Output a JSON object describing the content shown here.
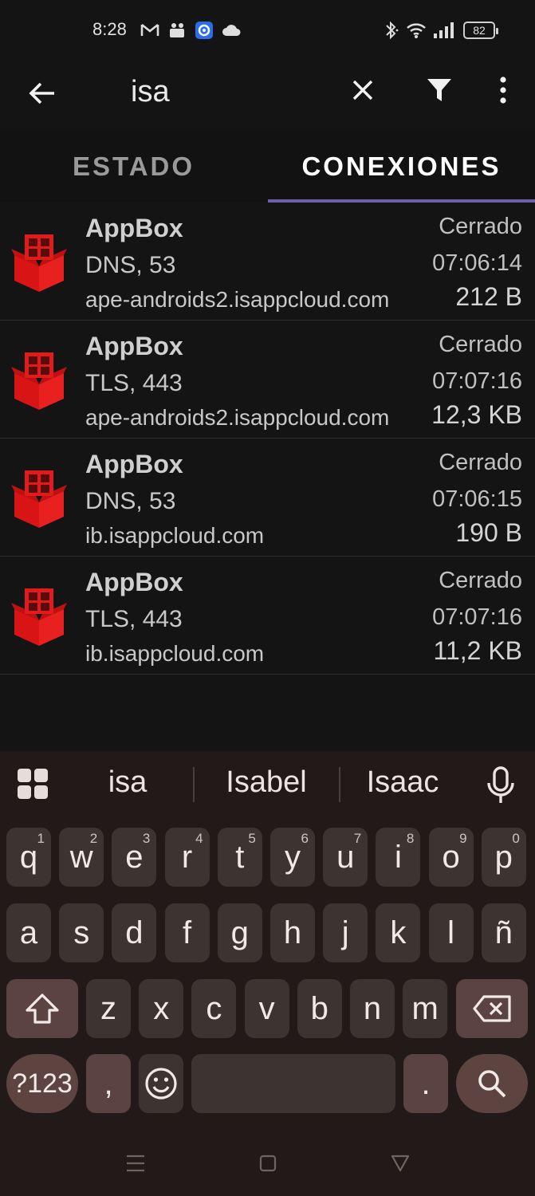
{
  "status_bar": {
    "time": "8:28",
    "left_icons": [
      "gmail-icon",
      "teams-icon",
      "app-icon",
      "cloud-icon"
    ],
    "right_icons": [
      "bluetooth-icon",
      "wifi-icon",
      "signal-icon"
    ],
    "battery": "82"
  },
  "app_bar": {
    "search_text": "isa",
    "icons": [
      "back-arrow-icon",
      "close-icon",
      "filter-icon",
      "more-vert-icon"
    ]
  },
  "tabs": [
    {
      "label": "ESTADO",
      "active": false
    },
    {
      "label": "CONEXIONES",
      "active": true
    }
  ],
  "connections": [
    {
      "app": "AppBox",
      "protocol": "DNS, 53",
      "host": "ape-androids2.isappcloud.com",
      "status": "Cerrado",
      "time": "07:06:14",
      "size": "212 B"
    },
    {
      "app": "AppBox",
      "protocol": "TLS, 443",
      "host": "ape-androids2.isappcloud.com",
      "status": "Cerrado",
      "time": "07:07:16",
      "size": "12,3 KB"
    },
    {
      "app": "AppBox",
      "protocol": "DNS, 53",
      "host": "ib.isappcloud.com",
      "status": "Cerrado",
      "time": "07:06:15",
      "size": "190 B"
    },
    {
      "app": "AppBox",
      "protocol": "TLS, 443",
      "host": "ib.isappcloud.com",
      "status": "Cerrado",
      "time": "07:07:16",
      "size": "11,2 KB"
    }
  ],
  "keyboard": {
    "suggestions": [
      "isa",
      "Isabel",
      "Isaac"
    ],
    "row1": [
      {
        "key": "q",
        "hint": "1"
      },
      {
        "key": "w",
        "hint": "2"
      },
      {
        "key": "e",
        "hint": "3"
      },
      {
        "key": "r",
        "hint": "4"
      },
      {
        "key": "t",
        "hint": "5"
      },
      {
        "key": "y",
        "hint": "6"
      },
      {
        "key": "u",
        "hint": "7"
      },
      {
        "key": "i",
        "hint": "8"
      },
      {
        "key": "o",
        "hint": "9"
      },
      {
        "key": "p",
        "hint": "0"
      }
    ],
    "row2": [
      "a",
      "s",
      "d",
      "f",
      "g",
      "h",
      "j",
      "k",
      "l",
      "ñ"
    ],
    "row3": [
      "z",
      "x",
      "c",
      "v",
      "b",
      "n",
      "m"
    ],
    "symbols_label": "?123",
    "comma": ",",
    "period": "."
  },
  "colors": {
    "background": "#141414",
    "tab_indicator": "#6f5fa8",
    "app_icon_red": "#e01b1b",
    "keyboard_bg": "#211a19",
    "key_bg": "#3d3431",
    "key_func_bg": "#5a4340"
  }
}
